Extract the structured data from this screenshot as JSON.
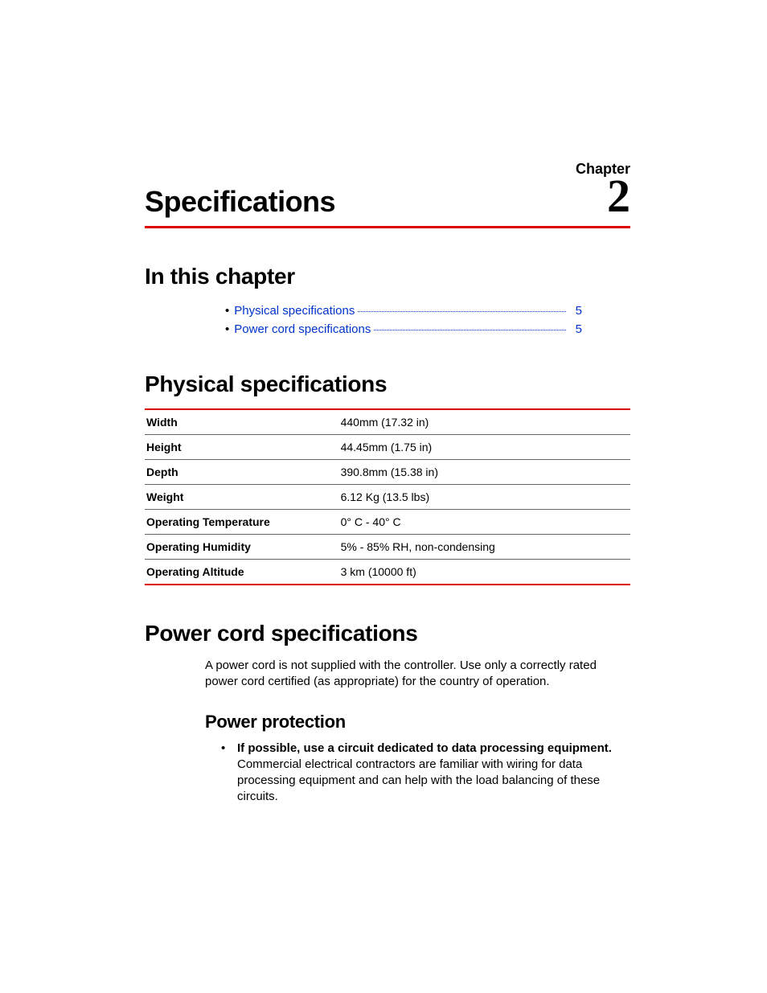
{
  "chapter": {
    "label": "Chapter",
    "number": "2",
    "title": "Specifications"
  },
  "sections": {
    "in_this_chapter": "In this chapter",
    "physical": "Physical specifications",
    "power_cord": "Power cord specifications",
    "power_protection": "Power protection"
  },
  "toc": [
    {
      "label": "Physical specifications",
      "page": "5"
    },
    {
      "label": "Power cord specifications",
      "page": "5"
    }
  ],
  "spec_table": [
    {
      "k": "Width",
      "v": "440mm (17.32 in)"
    },
    {
      "k": "Height",
      "v": "44.45mm (1.75 in)"
    },
    {
      "k": "Depth",
      "v": "390.8mm (15.38 in)"
    },
    {
      "k": "Weight",
      "v": "6.12 Kg (13.5 lbs)"
    },
    {
      "k": "Operating Temperature",
      "v": "0° C - 40° C"
    },
    {
      "k": "Operating Humidity",
      "v": "5% - 85% RH, non-condensing"
    },
    {
      "k": "Operating Altitude",
      "v": "3 km (10000 ft)"
    }
  ],
  "power_cord_intro": "A power cord is not supplied with the controller. Use only a correctly rated power cord certified (as appropriate) for the country of operation.",
  "power_protection_items": [
    {
      "lead": "If possible, use a circuit dedicated to data processing equipment.",
      "rest": " Commercial electrical contractors are familiar with wiring for data processing equipment and can help with the load balancing of these circuits."
    }
  ]
}
